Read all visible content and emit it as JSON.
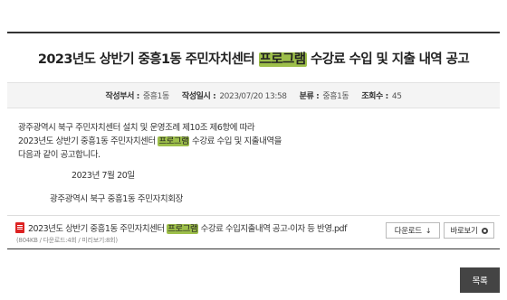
{
  "post": {
    "title_pre": "2023년도 상반기 중흥1동 주민자치센터 ",
    "title_hl": "프로그램",
    "title_post": " 수강료 수입 및 지출 내역 공고"
  },
  "meta": {
    "author_label": "작성부서 :",
    "author": "중흥1동",
    "date_label": "작성일시 :",
    "date": "2023/07/20 13:58",
    "category_label": "분류 :",
    "category": "중흥1동",
    "views_label": "조회수 :",
    "views": "45"
  },
  "body": {
    "line1": "광주광역시 북구 주민자치센터 설치 및 운영조례 제10조 제6항에 따라",
    "line2_pre": "2023년도 상반기 중흥1동 주민자치센터 ",
    "line2_hl": "프로그램",
    "line2_post": " 수강료 수입 및 지출내역을",
    "line3": "다음과 같이 공고합니다.",
    "date": "2023년 7월 20일",
    "signature": "광주광역시 북구 중흥1동 주민자치회장"
  },
  "attachment": {
    "name_pre": "2023년도 상반기 중흥1동 주민자치센터 ",
    "name_hl": "프로그램",
    "name_post": " 수강료 수입지출내역 공고-이자 등 반영.pdf",
    "info": "(804KB / 다운로드:4회 / 미리보기:8회)",
    "download_label": "다운로드",
    "preview_label": "바로보기"
  },
  "actions": {
    "list_label": "목록"
  },
  "colors": {
    "highlight": "#9dbf4a",
    "pdf_icon": "#dd2222",
    "list_button": "#444444"
  },
  "icons": {
    "file": "pdf-icon",
    "download": "download-arrow-icon",
    "preview": "eye-icon"
  }
}
